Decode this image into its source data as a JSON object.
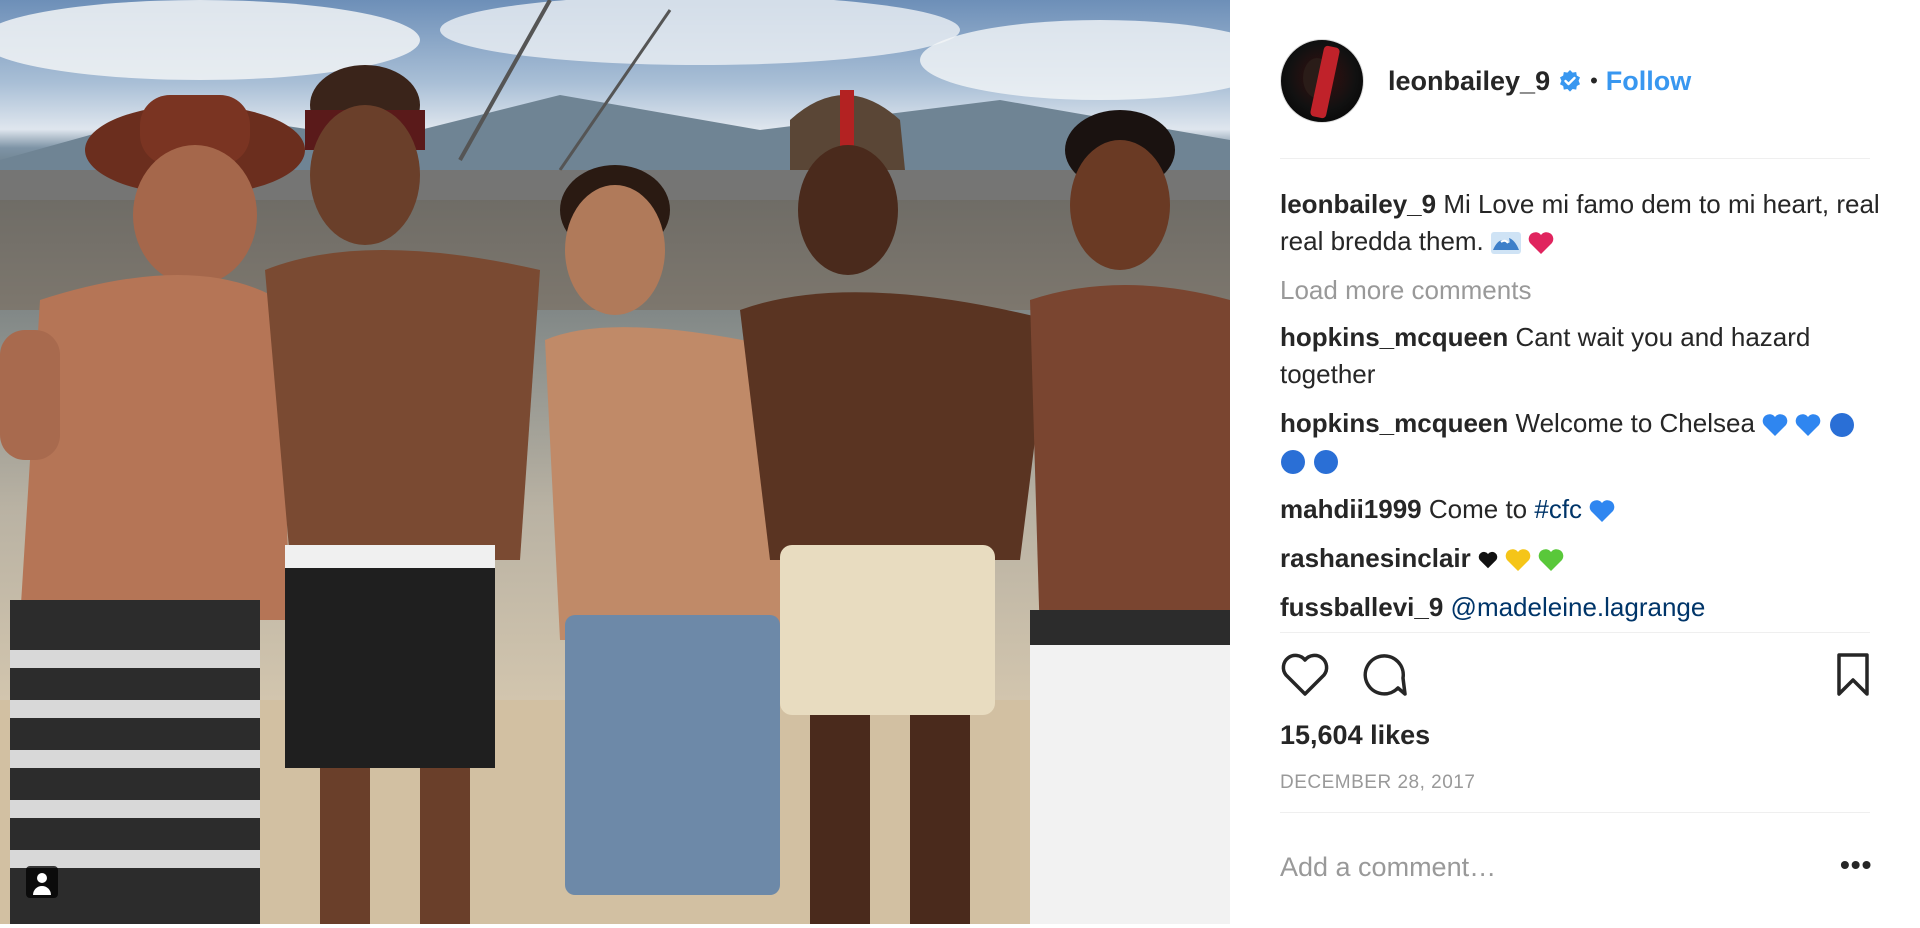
{
  "post": {
    "username": "leonbailey_9",
    "follow_label": "Follow",
    "separator": "•",
    "caption": {
      "author": "leonbailey_9",
      "text": "Mi Love mi famo dem to mi heart, real real bredda them."
    },
    "load_more_label": "Load more comments",
    "comments": [
      {
        "author": "hopkins_mcqueen",
        "text": "Cant wait you and hazard together"
      },
      {
        "author": "hopkins_mcqueen",
        "text": "Welcome to Chelsea"
      },
      {
        "author": "mahdii1999",
        "text": "Come to",
        "link": "#cfc"
      },
      {
        "author": "rashanesinclair",
        "text": ""
      },
      {
        "author": "fussballevi_9",
        "text": "",
        "link": "@madeleine.lagrange"
      }
    ],
    "likes": "15,604 likes",
    "date": "DECEMBER 28, 2017",
    "add_comment_placeholder": "Add a comment…",
    "more_label": "•••"
  },
  "icons": {
    "verified": "verified-badge-icon",
    "like": "heart-outline-icon",
    "comment": "comment-bubble-icon",
    "save": "bookmark-icon",
    "tag": "user-tag-icon"
  },
  "colors": {
    "accent": "#3897f0",
    "text": "#262626",
    "muted": "#999999",
    "divider": "#efefef",
    "heart_red": "#e0245e",
    "heart_blue": "#2f86f0",
    "heart_yellow": "#f5c518",
    "heart_green": "#59c83a"
  }
}
